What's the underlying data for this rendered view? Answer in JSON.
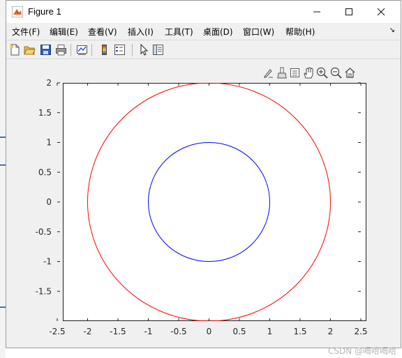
{
  "window": {
    "title": "Figure 1",
    "controls": {
      "minimize": "—",
      "maximize": "☐",
      "close": "✕"
    }
  },
  "menu": {
    "items": [
      "文件(F)",
      "编辑(E)",
      "查看(V)",
      "插入(I)",
      "工具(T)",
      "桌面(D)",
      "窗口(W)",
      "帮助(H)"
    ]
  },
  "toolbar": {
    "buttons": [
      "new-figure-icon",
      "open-file-icon",
      "save-icon",
      "print-icon",
      "link-plot-icon",
      "colorbar-icon",
      "legend-icon",
      "edit-plot-arrow-icon",
      "property-inspector-icon"
    ]
  },
  "axes_toolbar": {
    "buttons": [
      "brush-edit-icon",
      "data-brush-icon",
      "data-tips-icon",
      "pan-hand-icon",
      "zoom-in-icon",
      "zoom-out-icon",
      "home-restore-icon"
    ]
  },
  "chart_data": {
    "type": "line",
    "title": "",
    "xlabel": "",
    "ylabel": "",
    "xlim": [
      -2.5,
      2.5
    ],
    "ylim": [
      -2,
      2
    ],
    "xticks": [
      "-2.5",
      "-2",
      "-1.5",
      "-1",
      "-0.5",
      "0",
      "0.5",
      "1",
      "1.5",
      "2",
      "2.5"
    ],
    "yticks": [
      "2",
      "1.5",
      "1",
      "0.5",
      "0",
      "-0.5",
      "-1",
      "-1.5"
    ],
    "xtick_values": [
      -2.5,
      -2,
      -1.5,
      -1,
      -0.5,
      0,
      0.5,
      1,
      1.5,
      2,
      2.5
    ],
    "ytick_values": [
      2,
      1.5,
      1,
      0.5,
      0,
      -0.5,
      -1,
      -1.5
    ],
    "grid": false,
    "series": [
      {
        "shape": "circle",
        "center": [
          0,
          0
        ],
        "radius": 2,
        "color": "#ff0000"
      },
      {
        "shape": "circle",
        "center": [
          0,
          0
        ],
        "radius": 1,
        "color": "#0000ff"
      }
    ]
  },
  "watermark": "CSDN @喝哈喝哈"
}
